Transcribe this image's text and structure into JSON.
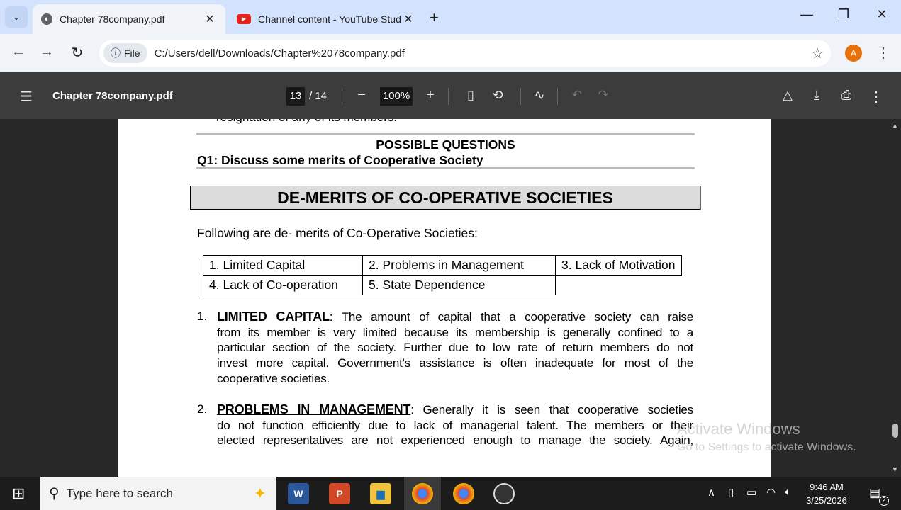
{
  "browser": {
    "tabs": [
      {
        "label": "Chapter 78company.pdf",
        "icon": "globe-icon",
        "active": true
      },
      {
        "label": "Channel content - YouTube Studio",
        "icon": "youtube-icon",
        "active": false
      }
    ],
    "new_tab": "+",
    "address": {
      "chip": "File",
      "url": "C:/Users/dell/Downloads/Chapter%2078company.pdf"
    },
    "avatar": "A"
  },
  "viewer": {
    "title": "Chapter 78company.pdf",
    "page_current": "13",
    "page_total": "/ 14",
    "zoom": "100%"
  },
  "document": {
    "cut_line": "resignation of any of its members.",
    "possible_questions": "POSSIBLE QUESTIONS",
    "q1": "Q1: Discuss some merits of Cooperative Society",
    "heading": "DE-MERITS OF CO-OPERATIVE SOCIETIES",
    "intro": "Following are de- merits of Co-Operative Societies:",
    "table": [
      [
        "1.  Limited Capital",
        "2.  Problems in Management",
        "3.  Lack of Motivation"
      ],
      [
        "4.  Lack of Co-operation",
        "5.  State Dependence",
        ""
      ]
    ],
    "sections": [
      {
        "num": "1.",
        "title": "LIMITED CAPITAL",
        "first": ": The amount of capital that a cooperative society can raise",
        "lines": [
          "from its member is very limited because its membership is generally confined to a",
          "particular section of the society. Further due to low rate of return members do not",
          "invest more capital. Government's assistance is often inadequate for most of the",
          "cooperative societies."
        ]
      },
      {
        "num": "2.",
        "title": "PROBLEMS IN MANAGEMENT",
        "first": ": Generally it is seen that cooperative societies",
        "lines": [
          "do not function efficiently due to lack of managerial talent. The members or their",
          "elected representatives are not experienced enough to manage the society. Again,"
        ]
      }
    ]
  },
  "watermark": {
    "line1": "Activate Windows",
    "line2": "Go to Settings to activate Windows."
  },
  "taskbar": {
    "search_placeholder": "Type here to search",
    "time": "9:46 AM",
    "date": "3/25/2026",
    "notifications": "2"
  }
}
